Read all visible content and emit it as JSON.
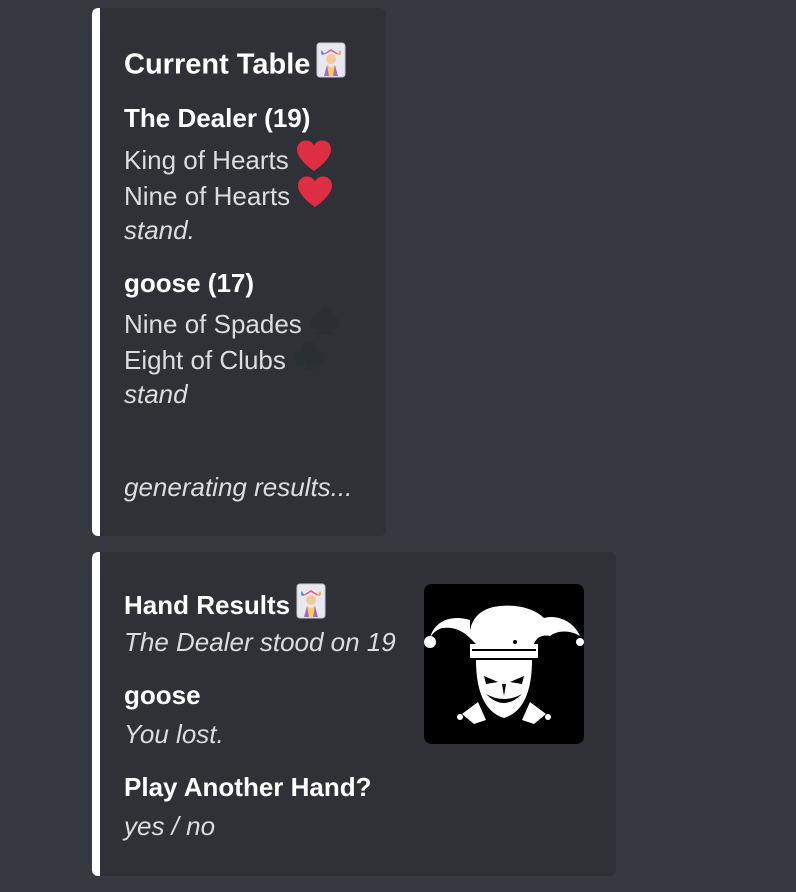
{
  "current_table": {
    "title": "Current Table",
    "title_icon": "joker-card-icon",
    "dealer": {
      "heading": "The Dealer (19)",
      "cards": [
        {
          "text": "King of Hearts",
          "suit_icon": "heart-icon"
        },
        {
          "text": "Nine of Hearts",
          "suit_icon": "heart-icon"
        }
      ],
      "action": "stand."
    },
    "player": {
      "heading": "goose (17)",
      "cards": [
        {
          "text": "Nine of Spades",
          "suit_icon": "spade-icon"
        },
        {
          "text": "Eight of Clubs",
          "suit_icon": "club-icon"
        }
      ],
      "action": "stand"
    },
    "footer": "generating results..."
  },
  "hand_results": {
    "title": "Hand Results",
    "title_icon": "joker-card-icon",
    "dealer_summary": "The Dealer stood on 19",
    "player_name": "goose",
    "player_outcome": "You lost.",
    "prompt_heading": "Play Another Hand?",
    "prompt_options": "yes / no",
    "thumbnail_icon": "jester-mask-icon"
  },
  "colors": {
    "background": "#36393f",
    "embed_background": "#2f3136",
    "embed_accent": "#ffffff",
    "heart": "#dd2e44",
    "dark_suit": "#292f33"
  }
}
